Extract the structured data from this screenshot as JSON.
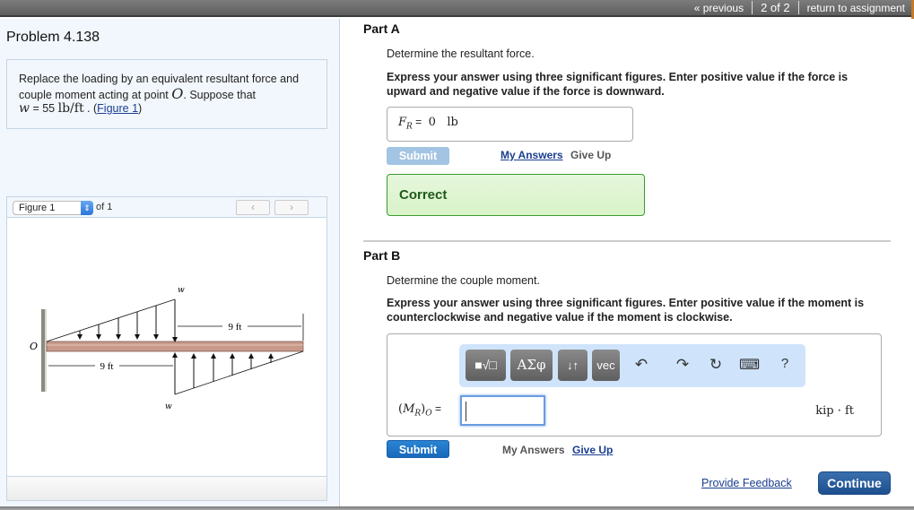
{
  "topnav": {
    "previous_label": "« previous",
    "position": "2 of 2",
    "return_label": "return to assignment"
  },
  "problem": {
    "title": "Problem 4.138",
    "statement_part1": "Replace the loading by an equivalent resultant force and couple moment acting at point ",
    "point_symbol": "O",
    "statement_part2": ". Suppose that",
    "w_symbol": "w",
    "w_equals": " = 55 ",
    "w_unit": "lb/ft",
    "figure_link_prefix": " . (",
    "figure_link": "Figure 1",
    "figure_link_suffix": ")"
  },
  "figure_panel": {
    "select_value": "Figure 1",
    "of_label": "of 1",
    "prev_icon": "‹",
    "next_icon": "›",
    "diagram": {
      "label_O": "O",
      "label_w_top": "w",
      "label_w_bottom": "w",
      "dim_top": "9 ft",
      "dim_bottom": "9 ft"
    }
  },
  "partA": {
    "title": "Part A",
    "question": "Determine the resultant force.",
    "instructions": "Express your answer using three significant figures. Enter positive value if the force is upward and negative value if the force is downward.",
    "answer_var": "F",
    "answer_sub": "R",
    "answer_eq": " = ",
    "answer_value": "0",
    "answer_unit": "lb",
    "submit_label": "Submit",
    "my_answers_label": "My Answers",
    "give_up_label": "Give Up",
    "feedback": "Correct"
  },
  "partB": {
    "title": "Part B",
    "question": "Determine the couple moment.",
    "instructions": "Express your answer using three significant figures. Enter positive value if the moment is counterclockwise and negative value if the moment is clockwise.",
    "toolbar": {
      "templates_label": "■√□",
      "greek_label": "ΑΣφ",
      "arrows_label": "↓↑",
      "vec_label": "vec",
      "undo_icon": "↶",
      "redo_icon": "↷",
      "reset_icon": "↻",
      "keyboard_icon": "⌨",
      "help_icon": "?"
    },
    "answer_label_open": "(",
    "answer_var": "M",
    "answer_sub": "R",
    "answer_label_close": ")",
    "answer_sub2": "O",
    "answer_eq": " =",
    "answer_value": "",
    "answer_unit": "kip · ft",
    "submit_label": "Submit",
    "my_answers_label": "My Answers",
    "give_up_label": "Give Up"
  },
  "footer": {
    "feedback_label": "Provide Feedback",
    "continue_label": "Continue"
  }
}
